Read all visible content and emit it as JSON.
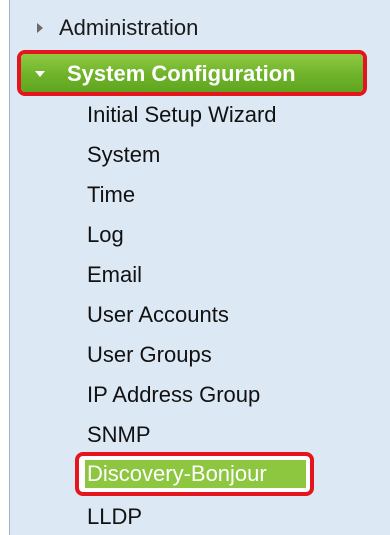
{
  "menu": {
    "administration": "Administration",
    "system_configuration": "System Configuration",
    "items": [
      "Initial Setup Wizard",
      "System",
      "Time",
      "Log",
      "Email",
      "User Accounts",
      "User Groups",
      "IP Address Group",
      "SNMP"
    ],
    "selected_item": "Discovery-Bonjour",
    "after_items": [
      "LLDP"
    ]
  },
  "colors": {
    "panel_bg": "#dce8f4",
    "selected_green": "#6fb32a",
    "highlight_red": "#e4151c"
  }
}
